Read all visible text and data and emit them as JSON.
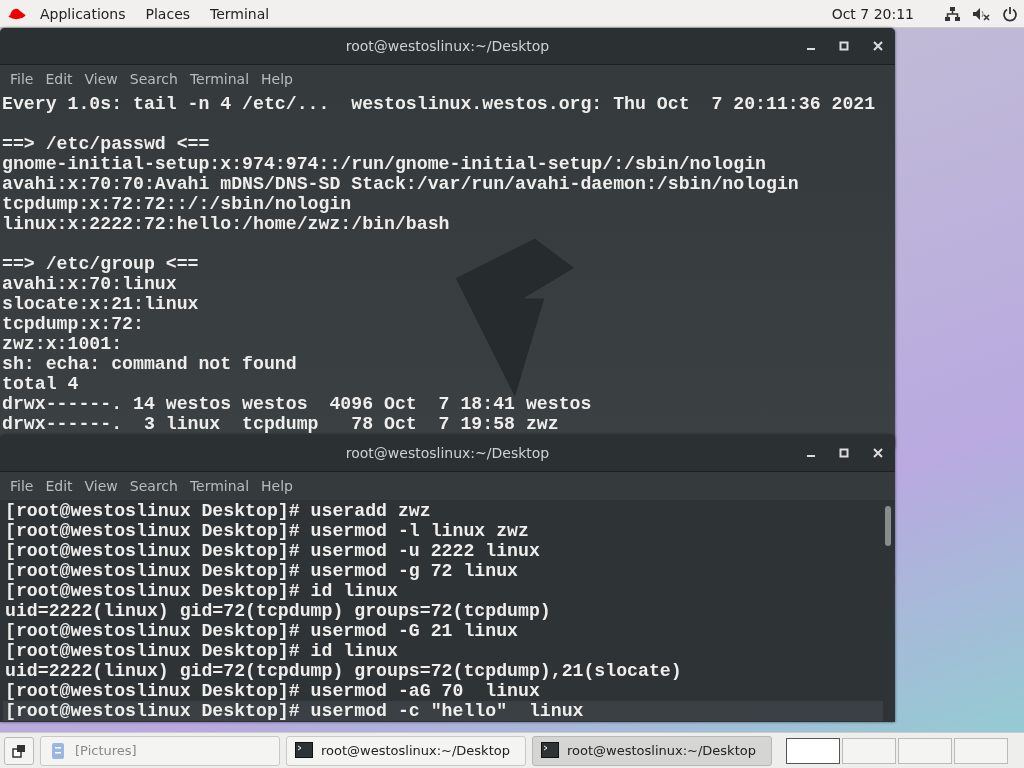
{
  "top_bar": {
    "menus": [
      "Applications",
      "Places",
      "Terminal"
    ],
    "clock": "Oct 7  20:11"
  },
  "windows": [
    {
      "title": "root@westoslinux:~/Desktop",
      "menu": [
        "File",
        "Edit",
        "View",
        "Search",
        "Terminal",
        "Help"
      ],
      "blocks": [
        [
          "Every 1.0s: tail -n 4 /etc/...  westoslinux.westos.org: Thu Oct  7 20:11:36 2021"
        ],
        [
          "==> /etc/passwd <==",
          "gnome-initial-setup:x:974:974::/run/gnome-initial-setup/:/sbin/nologin",
          "avahi:x:70:70:Avahi mDNS/DNS-SD Stack:/var/run/avahi-daemon:/sbin/nologin",
          "tcpdump:x:72:72::/:/sbin/nologin",
          "linux:x:2222:72:hello:/home/zwz:/bin/bash"
        ],
        [
          "==> /etc/group <==",
          "avahi:x:70:linux",
          "slocate:x:21:linux",
          "tcpdump:x:72:",
          "zwz:x:1001:",
          "sh: echa: command not found",
          "total 4",
          "drwx------. 14 westos westos  4096 Oct  7 18:41 westos",
          "drwx------.  3 linux  tcpdump   78 Oct  7 19:58 zwz"
        ]
      ]
    },
    {
      "title": "root@westoslinux:~/Desktop",
      "menu": [
        "File",
        "Edit",
        "View",
        "Search",
        "Terminal",
        "Help"
      ],
      "highlight_last_line": true,
      "blocks": [
        [
          "[root@westoslinux Desktop]# useradd zwz",
          "[root@westoslinux Desktop]# usermod -l linux zwz",
          "[root@westoslinux Desktop]# usermod -u 2222 linux",
          "[root@westoslinux Desktop]# usermod -g 72 linux",
          "[root@westoslinux Desktop]# id linux",
          "uid=2222(linux) gid=72(tcpdump) groups=72(tcpdump)",
          "[root@westoslinux Desktop]# usermod -G 21 linux",
          "[root@westoslinux Desktop]# id linux",
          "uid=2222(linux) gid=72(tcpdump) groups=72(tcpdump),21(slocate)",
          "[root@westoslinux Desktop]# usermod -aG 70  linux",
          "[root@westoslinux Desktop]# usermod -c \"hello\"  linux"
        ]
      ]
    }
  ],
  "taskbar": {
    "items": [
      {
        "label": "[Pictures]",
        "kind": "folder",
        "selected": false
      },
      {
        "label": "root@westoslinux:~/Desktop",
        "kind": "terminal",
        "selected": false
      },
      {
        "label": "root@westoslinux:~/Desktop",
        "kind": "terminal",
        "selected": true
      }
    ]
  }
}
